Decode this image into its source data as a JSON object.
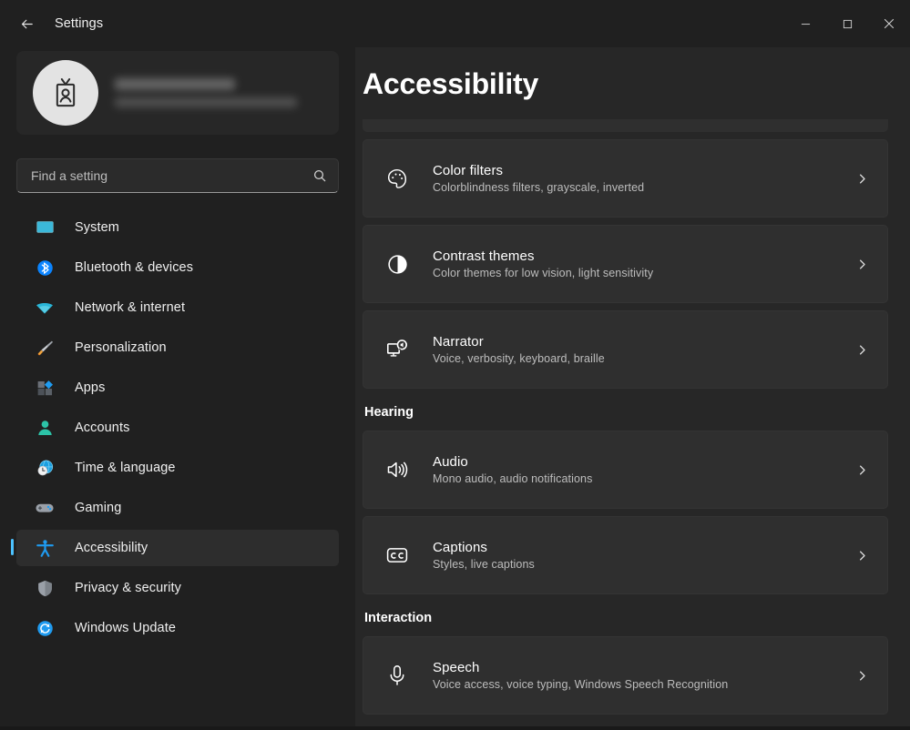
{
  "titlebar": {
    "back_icon": "back-arrow-icon",
    "title": "Settings",
    "minimize_label": "─",
    "maximize_label": "□",
    "close_label": "✕"
  },
  "sidebar": {
    "profile": {
      "avatar_icon": "id-badge-icon",
      "name": "",
      "email": ""
    },
    "search": {
      "placeholder": "Find a setting",
      "value": "",
      "icon": "search-icon"
    },
    "items": [
      {
        "label": "System",
        "icon": "monitor-icon",
        "active": false
      },
      {
        "label": "Bluetooth & devices",
        "icon": "bluetooth-icon",
        "active": false
      },
      {
        "label": "Network & internet",
        "icon": "wifi-icon",
        "active": false
      },
      {
        "label": "Personalization",
        "icon": "paintbrush-icon",
        "active": false
      },
      {
        "label": "Apps",
        "icon": "apps-grid-icon",
        "active": false
      },
      {
        "label": "Accounts",
        "icon": "person-icon",
        "active": false
      },
      {
        "label": "Time & language",
        "icon": "globe-clock-icon",
        "active": false
      },
      {
        "label": "Gaming",
        "icon": "gamepad-icon",
        "active": false
      },
      {
        "label": "Accessibility",
        "icon": "accessibility-person-icon",
        "active": true
      },
      {
        "label": "Privacy & security",
        "icon": "shield-icon",
        "active": false
      },
      {
        "label": "Windows Update",
        "icon": "update-refresh-icon",
        "active": false
      }
    ]
  },
  "main": {
    "page_title": "Accessibility",
    "cards_top": [
      {
        "title": "Color filters",
        "subtitle": "Colorblindness filters, grayscale, inverted",
        "icon": "color-palette-icon",
        "chevron": "chevron-right-icon"
      },
      {
        "title": "Contrast themes",
        "subtitle": "Color themes for low vision, light sensitivity",
        "icon": "contrast-circle-icon",
        "chevron": "chevron-right-icon"
      },
      {
        "title": "Narrator",
        "subtitle": "Voice, verbosity, keyboard, braille",
        "icon": "narrator-monitor-icon",
        "chevron": "chevron-right-icon"
      }
    ],
    "hearing": {
      "heading": "Hearing",
      "cards": [
        {
          "title": "Audio",
          "subtitle": "Mono audio, audio notifications",
          "icon": "speaker-icon",
          "chevron": "chevron-right-icon"
        },
        {
          "title": "Captions",
          "subtitle": "Styles, live captions",
          "icon": "closed-caption-icon",
          "chevron": "chevron-right-icon"
        }
      ]
    },
    "interaction": {
      "heading": "Interaction",
      "cards": [
        {
          "title": "Speech",
          "subtitle": "Voice access, voice typing, Windows Speech Recognition",
          "icon": "microphone-icon",
          "chevron": "chevron-right-icon"
        }
      ]
    }
  },
  "colors": {
    "accent": "#4cc2ff",
    "page_bg": "#272727",
    "sidebar_bg": "#202020",
    "card_bg": "#2f2f2f",
    "text_primary": "#ffffff",
    "text_secondary": "#bdbdbd"
  }
}
